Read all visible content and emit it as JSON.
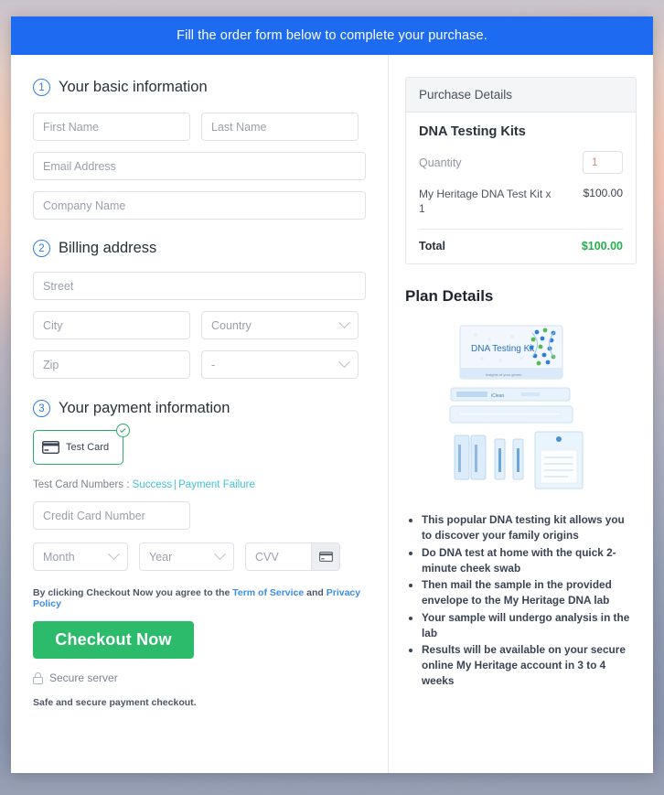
{
  "banner": {
    "text": "Fill the order form below to complete your purchase."
  },
  "sections": {
    "basic": {
      "number": "1",
      "title": "Your basic information",
      "first_name_placeholder": "First Name",
      "last_name_placeholder": "Last Name",
      "email_placeholder": "Email Address",
      "company_placeholder": "Company Name"
    },
    "billing": {
      "number": "2",
      "title": "Billing address",
      "street_placeholder": "Street",
      "city_placeholder": "City",
      "country_placeholder": "Country",
      "zip_placeholder": "Zip",
      "state_placeholder": "-"
    },
    "payment": {
      "number": "3",
      "title": "Your payment information",
      "method_label": "Test  Card",
      "method_icon": "credit-card-icon",
      "selected_icon": "check-circle-icon",
      "test_numbers_label": "Test Card Numbers : ",
      "test_success_link": "Success",
      "test_separator": "|",
      "test_failure_link": "Payment Failure",
      "card_number_placeholder": "Credit Card Number",
      "month_placeholder": "Month",
      "year_placeholder": "Year",
      "cvv_placeholder": "CVV",
      "cvv_icon": "credit-card-icon"
    }
  },
  "footer": {
    "terms_prefix": "By clicking Checkout Now you agree to the ",
    "terms_link": "Term of Service",
    "terms_middle": " and ",
    "privacy_link": "Privacy Policy",
    "checkout_label": "Checkout Now",
    "secure_icon": "lock-icon",
    "secure_label": "Secure server",
    "safe_note": "Safe and secure payment checkout."
  },
  "purchase": {
    "header": "Purchase Details",
    "product_title": "DNA Testing Kits",
    "quantity_label": "Quantity",
    "quantity_value": "1",
    "line_item_name": "My Heritage DNA Test Kit x 1",
    "line_item_price": "$100.00",
    "total_label": "Total",
    "total_value": "$100.00"
  },
  "plan": {
    "title": "Plan Details",
    "image_alt": "dna-testing-kit-product-image",
    "image_caption": "DNA Testing Kit",
    "image_subcaption": "Insights of your genes",
    "features": [
      "This popular DNA testing kit allows you to discover your family origins",
      "Do DNA test at home with the quick 2-minute cheek swab",
      "Then mail the sample in the provided envelope to the My Heritage DNA lab",
      "Your sample will undergo analysis in the lab",
      "Results will be available on your secure online My Heritage account in 3 to 4 weeks"
    ]
  },
  "colors": {
    "banner_blue": "#1d6bf0",
    "accent_green": "#2cbb6b",
    "link_cyan": "#3fc2d4",
    "link_blue": "#3a8df0",
    "total_green": "#22b14c",
    "step_blue": "#2b7de9"
  }
}
